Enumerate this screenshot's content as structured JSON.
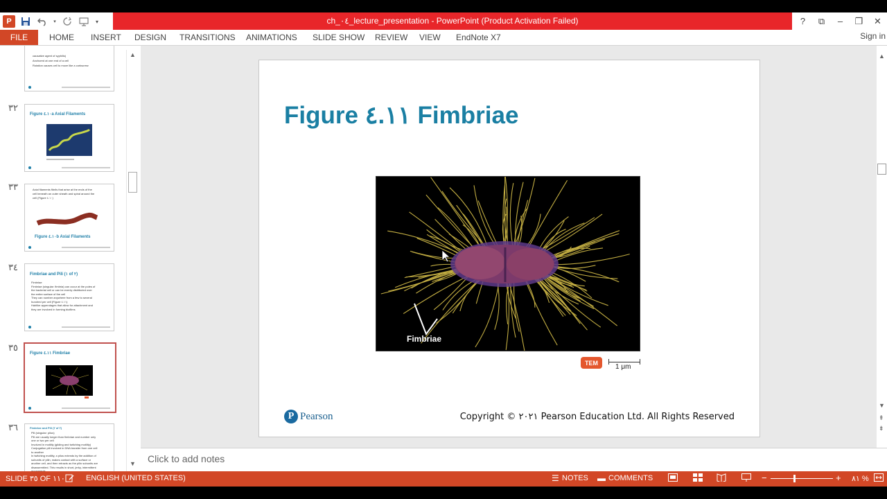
{
  "window": {
    "title": "ch_٠٤_lecture_presentation - PowerPoint (Product Activation Failed)",
    "controls": [
      "?",
      "⧉",
      "–",
      "❐",
      "✕"
    ]
  },
  "qat": {
    "icons": [
      "powerpoint-logo",
      "save-icon",
      "undo-icon",
      "redo-icon",
      "customize-icon"
    ]
  },
  "ribbon": {
    "file": "FILE",
    "tabs": [
      "HOME",
      "INSERT",
      "DESIGN",
      "TRANSITIONS",
      "ANIMATIONS",
      "SLIDE SHOW",
      "REVIEW",
      "VIEW",
      "EndNote X7"
    ],
    "signin": "Sign in"
  },
  "thumbnails": [
    {
      "num": "",
      "title": "",
      "lines": [
        "causative agent of syphilis)",
        "Anchored at one end of a cell",
        "Rotation causes cell to move like a corkscrew"
      ]
    },
    {
      "num": "٣٢",
      "title": "Figure ٤.١٠a Axial Filaments"
    },
    {
      "num": "٣٣",
      "title": "Figure ٤.١٠b Axial Filaments",
      "lines": [
        "Axial filaments fibrils that arise at the ends of the",
        "cell beneath an outer sheath and spiral around the",
        "cell (Figure ٤.١٠)"
      ]
    },
    {
      "num": "٣٤",
      "title": "Fimbriae and Pili (١ of ٢)",
      "lines": [
        "Fimbriae",
        "Fimbriae (singular: fimbria) can occur at the poles of",
        "the bacterial cell or can be evenly distributed over",
        "the entire surface of the cell",
        "They can number anywhere from a few to several",
        "hundred per cell (Figure ٤.١١)",
        "Hairlike appendages that allow for attachment and",
        "they are involved in forming biofilms"
      ]
    },
    {
      "num": "٣٥",
      "title": "Figure ٤.١١ Fimbriae",
      "selected": true
    },
    {
      "num": "٣٦",
      "title": "Fimbriae and Pili (٢ of ٢)",
      "lines": [
        "Pili (singular: pilus)",
        "Pili are usually longer than fimbriae and number only",
        "one or two per cell",
        "Involved in motility (gliding and twitching motility)",
        "Conjugation pili involved in DNA transfer from one cell",
        "to another",
        "In twitching motility, a pilus extends by the addition of",
        "subunits of pilin, makes contact with a surface or",
        "another cell, and then retracts as the pilin subunits are",
        "disassembled. This results in short, jerky, intermittent",
        "movements"
      ]
    }
  ],
  "slide": {
    "title": "Figure ٤.١١ Fimbriae",
    "image_label": "Fimbriae",
    "tem": "TEM",
    "scale": "1 μm",
    "brand": "Pearson",
    "copyright": "Copyright © ٢٠٢١ Pearson Education Ltd. All Rights Reserved"
  },
  "notes": {
    "placeholder": "Click to add notes"
  },
  "status": {
    "slide": "SLIDE ٣٥ OF ١١٠",
    "language": "ENGLISH (UNITED STATES)",
    "notes": "NOTES",
    "comments": "COMMENTS",
    "zoom": "٨١ %"
  },
  "colors": {
    "accent": "#d24726",
    "title_bar": "#e8262a",
    "slide_title": "#1a7fa3"
  }
}
